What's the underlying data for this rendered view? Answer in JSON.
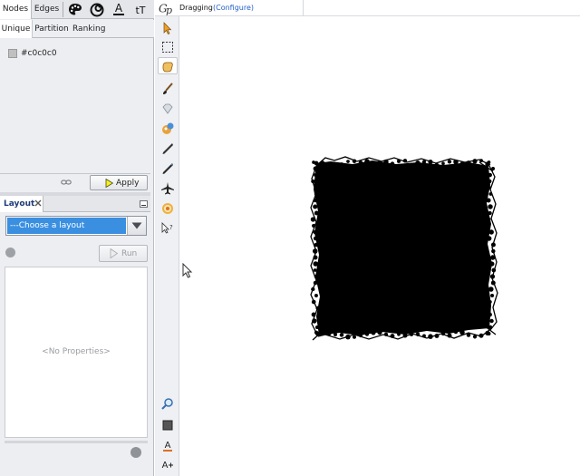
{
  "appearance": {
    "tabs": [
      "Nodes",
      "Edges"
    ],
    "icons": [
      "palette-icon",
      "size-icon",
      "label-color-icon",
      "label-size-icon"
    ],
    "label_color_glyph": "A",
    "label_size_glyph": "tT",
    "subtabs": [
      "Unique",
      "Partition",
      "Ranking"
    ],
    "unique_color": "#c0c0c0",
    "unique_color_label": "#c0c0c0",
    "apply_label": "Apply"
  },
  "layout": {
    "title": "Layout",
    "select_value": "---Choose a layout",
    "run_label": "Run",
    "no_properties": "<No Properties>"
  },
  "graph": {
    "mode_label": "Dragging",
    "configure_label": "(Configure)",
    "node_color": "#000000"
  },
  "colors": {
    "accent": "#3a8fe0",
    "link": "#2560c9",
    "layout_title": "#1c3b78",
    "panel_bg": "#eceef2"
  }
}
